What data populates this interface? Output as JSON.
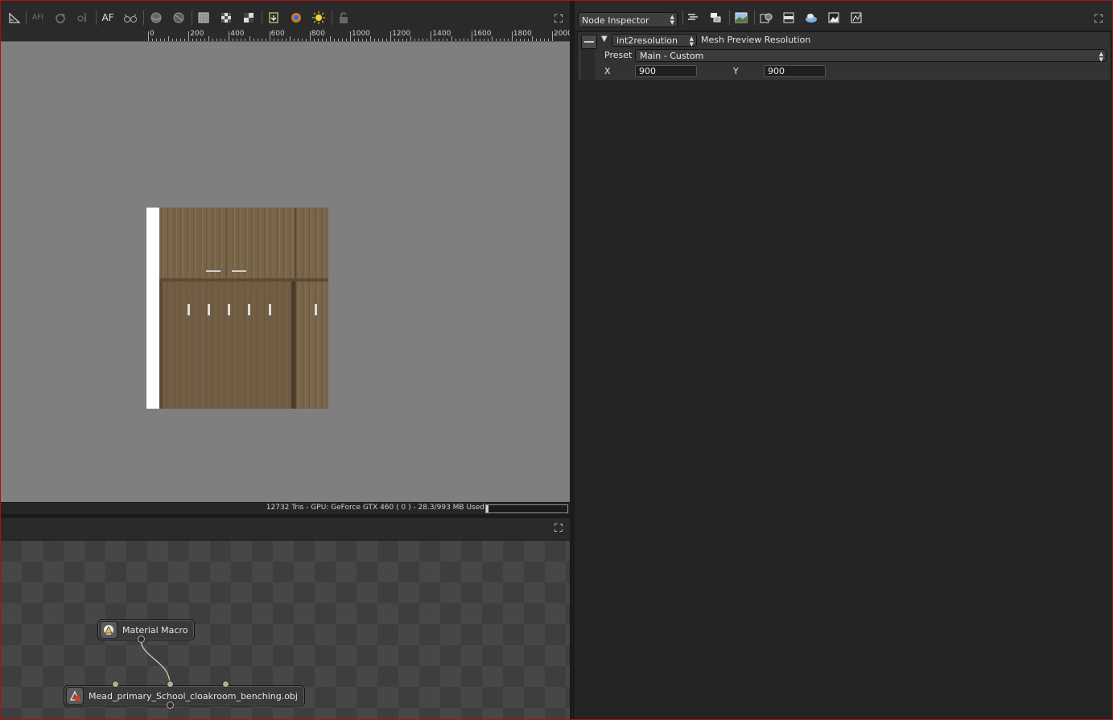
{
  "viewer": {
    "toolbar_icons": [
      "ruler-icon",
      "af-filter-icon",
      "rotate-icon",
      "info-icon",
      "af-icon",
      "glasses-icon",
      "sphere-icon",
      "sphere-alt-icon",
      "checker-fill-icon",
      "checker-icon",
      "checker-small-icon",
      "import-icon",
      "color-picker-icon",
      "light-icon",
      "lock-icon"
    ],
    "af_label": "AF",
    "ruler_labels": [
      "0",
      "200",
      "400",
      "600",
      "800",
      "1000",
      "1200",
      "1400",
      "1600",
      "1800",
      "2000"
    ],
    "status": "12732 Tris - GPU: GeForce GTX 460 ( 0 ) - 28.3/993 MB Used",
    "gpu_usage_fraction": 0.03,
    "expand_icon": "expand-icon"
  },
  "flow": {
    "nodes": {
      "material_macro": {
        "label": "Material Macro",
        "icon": "material-icon"
      },
      "obj_loader": {
        "label": "Mead_primary_School_cloakroom_benching.obj",
        "icon": "mesh-icon"
      }
    }
  },
  "inspector": {
    "dropdown": "Node Inspector",
    "toolbar_icons": [
      "layers-icon",
      "stack-icon",
      "image-icon",
      "render-icon",
      "bar-icon",
      "cloud-icon",
      "photo-icon",
      "graph-icon"
    ],
    "param": {
      "type": "int2resolution",
      "name": "Mesh Preview Resolution",
      "preset_label": "Preset",
      "preset_value": "Main - Custom",
      "x_label": "X",
      "x_value": "900",
      "y_label": "Y",
      "y_value": "900"
    }
  }
}
